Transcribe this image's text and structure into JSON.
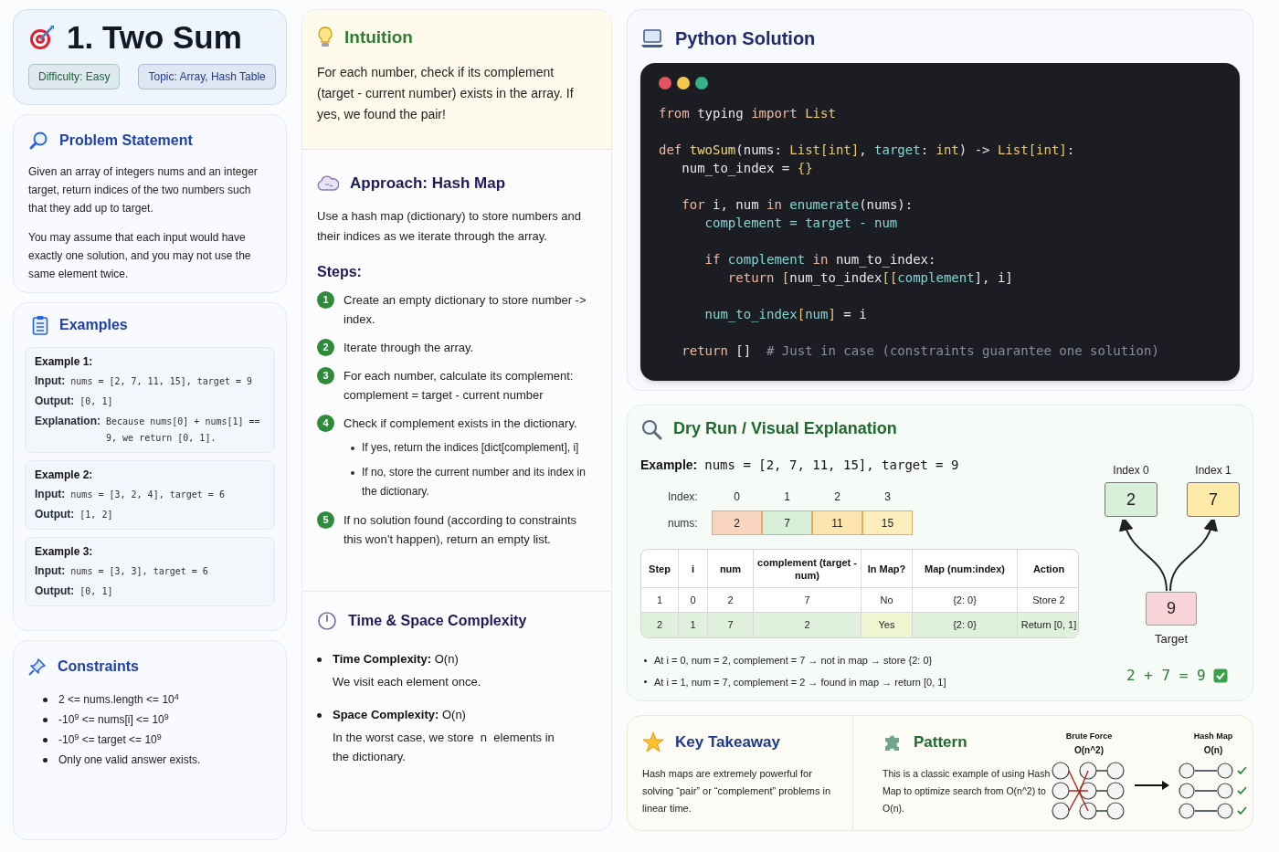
{
  "header": {
    "title": "1. Two Sum",
    "tags": [
      {
        "label": "Difficulty: Easy",
        "color": "#166534"
      },
      {
        "label": "Topic: Array, Hash Table",
        "color": "#1e3a8a"
      }
    ]
  },
  "problem": {
    "heading": "Problem Statement",
    "paragraphs": [
      "Given an array of integers nums and an integer target, return indices of the two numbers such that they add up to target.",
      "You may assume that each input would have exactly one solution, and you may not use the same element twice."
    ]
  },
  "examples": {
    "heading": "Examples",
    "items": [
      {
        "title": "Example 1:",
        "lines": [
          {
            "label": "Input:",
            "value": "nums = [2, 7, 11, 15], target = 9"
          },
          {
            "label": "Output:",
            "value": "[0, 1]"
          },
          {
            "label": "Explanation:",
            "value": "Because nums[0] + nums[1] == 9, we return [0, 1]."
          }
        ]
      },
      {
        "title": "Example 2:",
        "lines": [
          {
            "label": "Input:",
            "value": "nums = [3, 2, 4], target = 6"
          },
          {
            "label": "Output:",
            "value": "[1, 2]"
          }
        ]
      },
      {
        "title": "Example 3:",
        "lines": [
          {
            "label": "Input:",
            "value": "nums = [3, 3], target = 6"
          },
          {
            "label": "Output:",
            "value": "[0, 1]"
          }
        ]
      }
    ]
  },
  "constraints": {
    "heading": "Constraints",
    "items": [
      "2 <= nums.length <= 10$^{4}$",
      "-10$^{9}$ <= nums[i] <= 10$^{9}$",
      "-10$^{9}$ <= target <= 10$^{9}$",
      "Only one valid answer exists."
    ]
  },
  "intuition": {
    "heading": "Intuition",
    "text": "For each number, check if its complement (target - current number) exists in the array. If yes, we found the pair!"
  },
  "approach": {
    "heading": "Approach: Hash Map",
    "text": "Use a hash map (dictionary) to store numbers and their indices as we iterate through the array.",
    "steps_heading": "Steps:",
    "steps": [
      {
        "number": "1",
        "lines": [
          "Create an empty dictionary to store number -> index."
        ]
      },
      {
        "number": "2",
        "lines": [
          "Iterate through the array."
        ]
      },
      {
        "number": "3",
        "lines": [
          "For each number, calculate its complement:",
          "complement = target - current number"
        ]
      },
      {
        "number": "4",
        "lines": [
          "Check if complement exists in the dictionary."
        ],
        "children": [
          "If yes, return the indices [dict[complement], i]",
          "If no, store the current number and its index in the dictionary."
        ]
      },
      {
        "number": "5",
        "lines": [
          "If no solution found (according to constraints this won’t happen), return an empty list."
        ]
      }
    ]
  },
  "complexity": {
    "heading": "Time & Space Complexity",
    "items": [
      {
        "title": "**Time Complexity:** O(n)",
        "note": "We visit each element once."
      },
      {
        "title": "**Space Complexity:** O(n)",
        "note": "In the worst case, we store  n  elements in the dictionary."
      }
    ]
  },
  "solution": {
    "heading": "Python Solution",
    "code_lines": [
      {
        "tokens": [
          {
            "kind": "kw",
            "text": "from"
          },
          {
            "kind": "p",
            "text": " typing "
          },
          {
            "kind": "kw",
            "text": "import"
          },
          {
            "kind": "ty",
            "text": " List"
          }
        ]
      },
      {
        "blank_before": true,
        "tokens": [
          {
            "kind": "kw",
            "text": "def"
          },
          {
            "kind": "fn",
            "text": " twoSum"
          },
          {
            "kind": "p",
            "text": "(nums: "
          },
          {
            "kind": "ty",
            "text": "List[int]"
          },
          {
            "kind": "p",
            "text": ", "
          },
          {
            "kind": "v",
            "text": "target"
          },
          {
            "kind": "p",
            "text": ": "
          },
          {
            "kind": "ty",
            "text": "int"
          },
          {
            "kind": "p",
            "text": ") -> "
          },
          {
            "kind": "ty",
            "text": "List[int]"
          },
          {
            "kind": "p",
            "text": ":"
          }
        ]
      },
      {
        "tokens": [
          {
            "kind": "p",
            "text": "   num_to_index = "
          },
          {
            "kind": "ty",
            "text": "{}"
          }
        ]
      },
      {
        "blank_before": true,
        "tokens": [
          {
            "kind": "kw",
            "text": "   for"
          },
          {
            "kind": "p",
            "text": " i, num "
          },
          {
            "kind": "kw",
            "text": "in"
          },
          {
            "kind": "v",
            "text": " enumerate"
          },
          {
            "kind": "p",
            "text": "(nums):"
          }
        ]
      },
      {
        "tokens": [
          {
            "kind": "v",
            "text": "      complement = target - num"
          }
        ]
      },
      {
        "blank_before": true,
        "tokens": [
          {
            "kind": "kw",
            "text": "      if"
          },
          {
            "kind": "v",
            "text": " complement"
          },
          {
            "kind": "kw",
            "text": " in"
          },
          {
            "kind": "p",
            "text": " num_to_index:"
          }
        ]
      },
      {
        "tokens": [
          {
            "kind": "kw",
            "text": "         return"
          },
          {
            "kind": "ty",
            "text": " ["
          },
          {
            "kind": "p",
            "text": "num_to_index"
          },
          {
            "kind": "ty",
            "text": "[["
          },
          {
            "kind": "v",
            "text": "complement"
          },
          {
            "kind": "p",
            "text": "], i]"
          }
        ]
      },
      {
        "blank_before": true,
        "tokens": [
          {
            "kind": "v",
            "text": "      num_to_index"
          },
          {
            "kind": "ty",
            "text": "["
          },
          {
            "kind": "v",
            "text": "num"
          },
          {
            "kind": "ty",
            "text": "]"
          },
          {
            "kind": "p",
            "text": " = i"
          }
        ]
      },
      {
        "blank_before": true,
        "tokens": [
          {
            "kind": "kw",
            "text": "   return"
          },
          {
            "kind": "p",
            "text": " []  "
          },
          {
            "kind": "c",
            "text": "# Just in case (constraints guarantee one solution)"
          }
        ]
      }
    ]
  },
  "dry_run": {
    "heading": "Dry Run / Visual Explanation",
    "example_label": "Example:",
    "example_value": "nums = [2, 7, 11, 15], target = 9",
    "index_label": "Index:",
    "nums_label": "nums:",
    "cells": [
      {
        "index": "0",
        "value": "2",
        "color": "#f9d5c0"
      },
      {
        "index": "1",
        "value": "7",
        "color": "#d8efd9"
      },
      {
        "index": "2",
        "value": "11",
        "color": "#fde4ae"
      },
      {
        "index": "3",
        "value": "15",
        "color": "#fdedba"
      }
    ],
    "table": {
      "columns": [
        "Step",
        "i",
        "num",
        "complement (target - num)",
        "In Map?",
        "Map (num:index)",
        "Action"
      ],
      "rows": [
        {
          "highlighted": false,
          "cells": [
            "1",
            "0",
            "2",
            "7",
            "No",
            "{2: 0}",
            "Store 2"
          ]
        },
        {
          "highlighted": true,
          "cells": [
            "2",
            "1",
            "7",
            "2",
            "Yes",
            "{2: 0}",
            "Return [0, 1]"
          ]
        }
      ]
    },
    "notes": [
      "At i = 0, num = 2, complement = 7 → not in map → store {2: 0}",
      "At i = 1, num = 7, complement = 2 → found in map → return [0, 1]"
    ],
    "pair": [
      {
        "label": "Index 0",
        "value": "2",
        "color": "#d8efd9"
      },
      {
        "label": "Index 1",
        "value": "7",
        "color": "#fde9a8"
      }
    ],
    "target": {
      "label": "Target",
      "value": "9",
      "color": "#f8d3d8"
    },
    "equation": "2 + 7 = 9"
  },
  "takeaway": {
    "heading": "Key Takeaway",
    "text": "Hash maps are extremely powerful for solving “pair” or “complement” problems in linear time."
  },
  "pattern": {
    "heading": "Pattern",
    "text": "This is a classic example of using Hash Map to optimize search from O(n^2) to O(n).",
    "before_label": "Brute Force",
    "before_complexity": "O(n^2)",
    "after_label": "Hash Map",
    "after_complexity": "O(n)"
  }
}
